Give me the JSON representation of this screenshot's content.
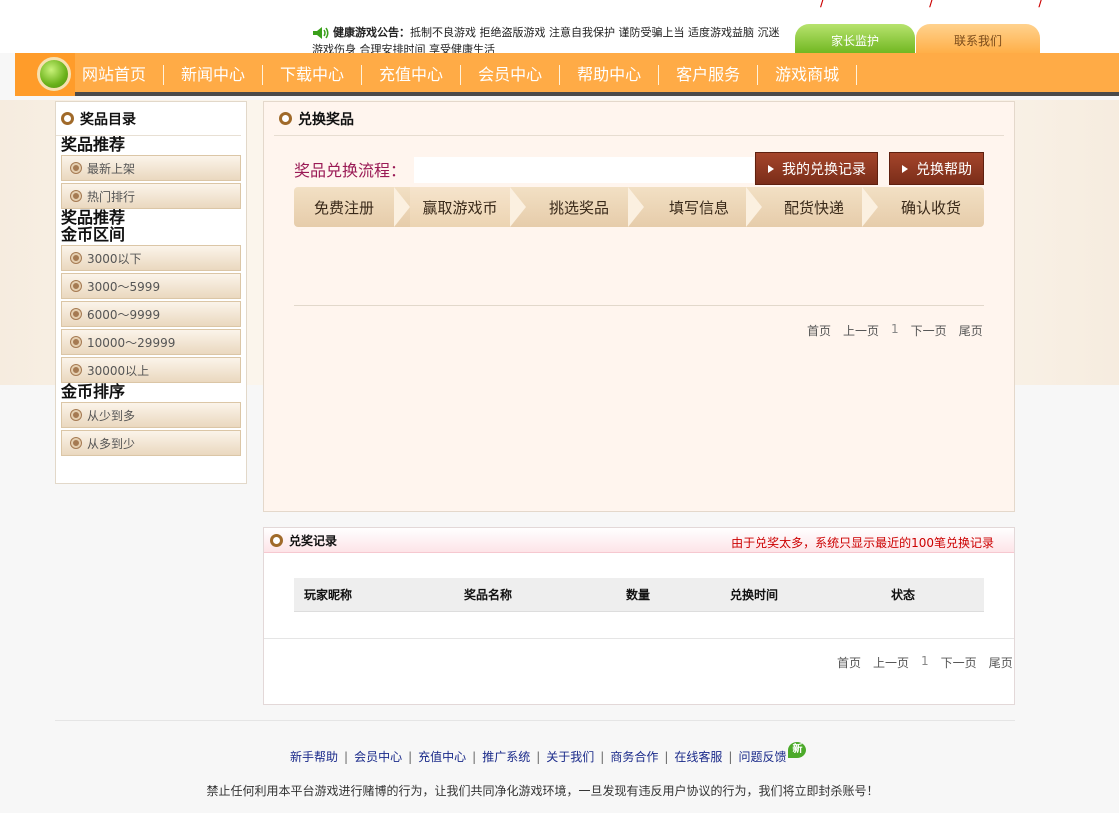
{
  "header": {
    "red_marks": "/ / /",
    "notice_label": "健康游戏公告：",
    "notice_text": "抵制不良游戏  拒绝盗版游戏  注意自我保护  谨防受骗上当  适度游戏益脑  沉迷游戏伤身  合理安排时间  享受健康生活",
    "tab_parent": "家长监护",
    "tab_contact": "联系我们"
  },
  "nav": {
    "items": [
      "网站首页",
      "新闻中心",
      "下载中心",
      "充值中心",
      "会员中心",
      "帮助中心",
      "客户服务",
      "游戏商城"
    ]
  },
  "sidebar": {
    "title": "奖品目录",
    "section1": "奖品推荐",
    "items1": [
      "最新上架",
      "热门排行"
    ],
    "section2a": "奖品推荐",
    "section2b": "金币区间",
    "items2": [
      "3000以下",
      "3000～5999",
      "6000～9999",
      "10000～29999",
      "30000以上"
    ],
    "section3": "金币排序",
    "items3": [
      "从少到多",
      "从多到少"
    ]
  },
  "main": {
    "title": "兑换奖品",
    "flow_title": "奖品兑换流程：",
    "btn_records": "我的兑换记录",
    "btn_help": "兑换帮助",
    "steps": [
      "免费注册",
      "赢取游戏币",
      "挑选奖品",
      "填写信息",
      "配货快递",
      "确认收货"
    ],
    "pager": [
      "首页",
      "上一页",
      "1",
      "下一页",
      "尾页"
    ]
  },
  "records": {
    "title": "兑奖记录",
    "note": "由于兑奖太多，系统只显示最近的100笔兑换记录",
    "columns": [
      "玩家昵称",
      "奖品名称",
      "数量",
      "兑换时间",
      "状态"
    ],
    "pager": [
      "首页",
      "上一页",
      "1",
      "下一页",
      "尾页"
    ]
  },
  "footer": {
    "links": [
      "新手帮助",
      "会员中心",
      "充值中心",
      "推广系统",
      "关于我们",
      "商务合作",
      "在线客服",
      "问题反馈"
    ],
    "new_badge": "新",
    "warning": "禁止任何利用本平台游戏进行赌博的行为，让我们共同净化游戏环境，一旦发现有违反用户协议的行为，我们将立即封杀账号！"
  }
}
